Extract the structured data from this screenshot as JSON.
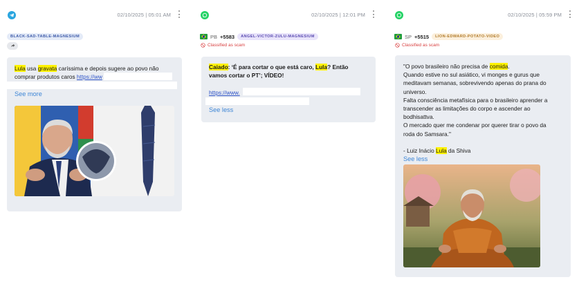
{
  "cards": [
    {
      "app": "telegram",
      "app_icon": "telegram-icon",
      "timestamp": "02/10/2025 | 05:01 AM",
      "tag": "BLACK-SAD-TABLE-MAGNESIUM",
      "text_parts": [
        "Lula",
        " usa ",
        "gravata",
        " caríssima e depois sugere ao povo não comprar produtos caros "
      ],
      "link": "https://ww",
      "toggle": "See more"
    },
    {
      "app": "whatsapp",
      "app_icon": "whatsapp-icon",
      "timestamp": "02/10/2025 | 12:01 PM",
      "state": "PB",
      "phone": "+5583",
      "tag": "ANGEL-VICTOR-ZULU-MAGNESIUM",
      "classification": "Classified as scam",
      "text_parts": [
        "Caiado",
        ": ‘É para cortar o que está caro, ",
        "Lula",
        "? Então vamos cortar o PT’; VÍDEO!"
      ],
      "link": "https://www.",
      "toggle": "See less"
    },
    {
      "app": "whatsapp",
      "app_icon": "whatsapp-icon",
      "timestamp": "02/10/2025 | 05:59 PM",
      "state": "SP",
      "phone": "+5515",
      "tag": "LION-EDWARD-POTATO-VIDEO",
      "classification": "Classified as scam",
      "text_parts": {
        "l1a": "\"O povo brasileiro não precisa de ",
        "l1b": "comida",
        "l1c": ".",
        "l2": "Quando estive no sul asiático, vi monges e gurus que",
        "l3": "meditavam semanas, sobrevivendo apenas do prana do",
        "l4": "universo.",
        "l5": "Falta consciência metafísica para o brasileiro aprender a",
        "l6": "transcender as limitações do corpo e ascender ao",
        "l7": "bodhisattva.",
        "l8": "O mercado quer me condenar por querer tirar o povo da",
        "l9": "roda do Samsara.\"",
        "sig_a": "- Luiz Inácio ",
        "sig_b": "Lula",
        "sig_c": " da Shiva"
      },
      "toggle": "See less"
    }
  ],
  "colors": {
    "highlight": "#fff200",
    "link": "#2f54c8",
    "toggle": "#3e86d6",
    "scam": "#d84040",
    "bubble": "#eaedf2"
  }
}
